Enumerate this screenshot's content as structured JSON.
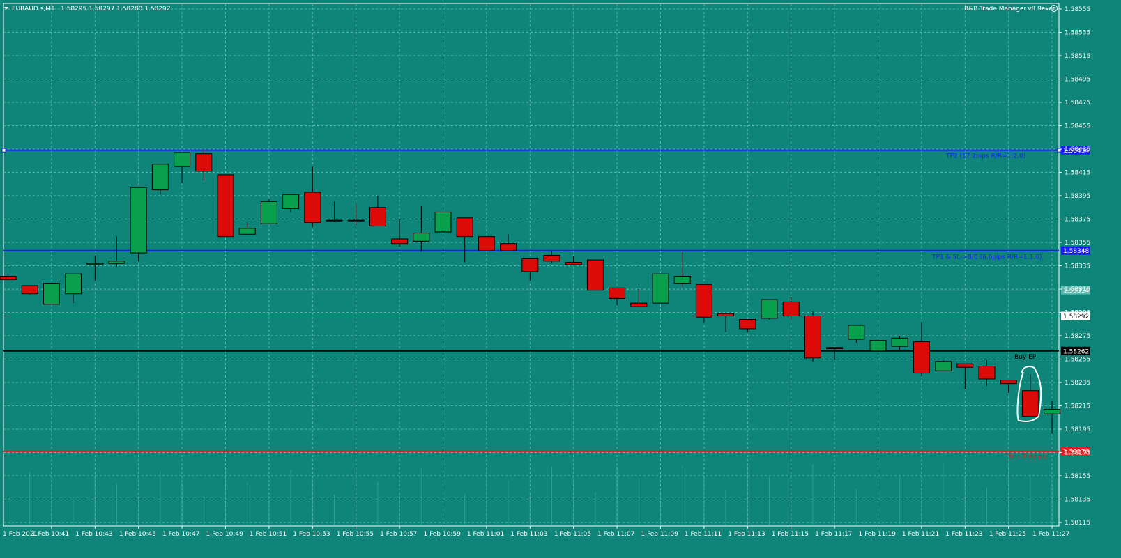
{
  "header": {
    "symbol_label": "EURAUD.s,M1",
    "ohlc_text": "1.58295 1.58297 1.58280 1.58292",
    "ea_label": "B&B Trade Manager.v8.9exec"
  },
  "colors": {
    "background": "#0f8478",
    "bull": "#08a04c",
    "bear": "#dd0a0a",
    "grid": "#5cb8ad",
    "tp_line": "#1a1aff",
    "entry_line": "#000000",
    "sl_line": "#e02020",
    "current_price": "#ffffff"
  },
  "chart_data": {
    "type": "candlestick",
    "symbol": "EURAUD.s",
    "timeframe": "M1",
    "y_range": [
      1.58115,
      1.58565
    ],
    "y_ticks": [
      "1.58555",
      "1.58535",
      "1.58515",
      "1.58495",
      "1.58475",
      "1.58455",
      "1.58435",
      "1.58415",
      "1.58395",
      "1.58375",
      "1.58355",
      "1.58335",
      "1.58315",
      "1.58295",
      "1.58275",
      "1.58255",
      "1.58235",
      "1.58215",
      "1.58195",
      "1.58175",
      "1.58155",
      "1.58135",
      "1.58115"
    ],
    "x_labels": [
      "1 Feb 2021",
      "1 Feb 10:41",
      "1 Feb 10:43",
      "1 Feb 10:45",
      "1 Feb 10:47",
      "1 Feb 10:49",
      "1 Feb 10:51",
      "1 Feb 10:53",
      "1 Feb 10:55",
      "1 Feb 10:57",
      "1 Feb 10:59",
      "1 Feb 11:01",
      "1 Feb 11:03",
      "1 Feb 11:05",
      "1 Feb 11:07",
      "1 Feb 11:09",
      "1 Feb 11:11",
      "1 Feb 11:13",
      "1 Feb 11:15",
      "1 Feb 11:17",
      "1 Feb 11:19",
      "1 Feb 11:21",
      "1 Feb 11:23",
      "1 Feb 11:25",
      "1 Feb 11:27"
    ],
    "candles": [
      {
        "o": 1.58326,
        "h": 1.58334,
        "l": 1.58324,
        "c": 1.58323
      },
      {
        "o": 1.58318,
        "h": 1.58318,
        "l": 1.5831,
        "c": 1.58311
      },
      {
        "o": 1.58302,
        "h": 1.5832,
        "l": 1.58302,
        "c": 1.5832
      },
      {
        "o": 1.58311,
        "h": 1.58328,
        "l": 1.58303,
        "c": 1.58328
      },
      {
        "o": 1.58336,
        "h": 1.58344,
        "l": 1.58322,
        "c": 1.58337
      },
      {
        "o": 1.58337,
        "h": 1.5836,
        "l": 1.58334,
        "c": 1.58339
      },
      {
        "o": 1.58346,
        "h": 1.58402,
        "l": 1.58339,
        "c": 1.58402
      },
      {
        "o": 1.584,
        "h": 1.58422,
        "l": 1.58396,
        "c": 1.58422
      },
      {
        "o": 1.5842,
        "h": 1.5843,
        "l": 1.58406,
        "c": 1.58432
      },
      {
        "o": 1.58431,
        "h": 1.58434,
        "l": 1.58408,
        "c": 1.58416
      },
      {
        "o": 1.58413,
        "h": 1.58413,
        "l": 1.5836,
        "c": 1.5836
      },
      {
        "o": 1.58362,
        "h": 1.58372,
        "l": 1.58362,
        "c": 1.58367
      },
      {
        "o": 1.58371,
        "h": 1.58392,
        "l": 1.58371,
        "c": 1.5839
      },
      {
        "o": 1.58384,
        "h": 1.58396,
        "l": 1.58381,
        "c": 1.58396
      },
      {
        "o": 1.58398,
        "h": 1.5842,
        "l": 1.58368,
        "c": 1.58372
      },
      {
        "o": 1.58374,
        "h": 1.5839,
        "l": 1.58373,
        "c": 1.58374
      },
      {
        "o": 1.58374,
        "h": 1.58388,
        "l": 1.5837,
        "c": 1.58374
      },
      {
        "o": 1.58385,
        "h": 1.58395,
        "l": 1.58369,
        "c": 1.58369
      },
      {
        "o": 1.58358,
        "h": 1.58375,
        "l": 1.58351,
        "c": 1.58354
      },
      {
        "o": 1.58356,
        "h": 1.58386,
        "l": 1.58347,
        "c": 1.58363
      },
      {
        "o": 1.58364,
        "h": 1.58381,
        "l": 1.58364,
        "c": 1.58381
      },
      {
        "o": 1.58376,
        "h": 1.58376,
        "l": 1.58338,
        "c": 1.5836
      },
      {
        "o": 1.5836,
        "h": 1.5836,
        "l": 1.58348,
        "c": 1.58348
      },
      {
        "o": 1.58354,
        "h": 1.58362,
        "l": 1.58348,
        "c": 1.58348
      },
      {
        "o": 1.58341,
        "h": 1.58341,
        "l": 1.58322,
        "c": 1.5833
      },
      {
        "o": 1.58344,
        "h": 1.58348,
        "l": 1.58337,
        "c": 1.58339
      },
      {
        "o": 1.58338,
        "h": 1.58343,
        "l": 1.58335,
        "c": 1.58336
      },
      {
        "o": 1.5834,
        "h": 1.5834,
        "l": 1.58314,
        "c": 1.58314
      },
      {
        "o": 1.58316,
        "h": 1.58316,
        "l": 1.58301,
        "c": 1.58307
      },
      {
        "o": 1.58303,
        "h": 1.58315,
        "l": 1.583,
        "c": 1.583
      },
      {
        "o": 1.58303,
        "h": 1.58328,
        "l": 1.58303,
        "c": 1.58328
      },
      {
        "o": 1.5832,
        "h": 1.58347,
        "l": 1.58317,
        "c": 1.58326
      },
      {
        "o": 1.58319,
        "h": 1.58319,
        "l": 1.58286,
        "c": 1.58291
      },
      {
        "o": 1.58294,
        "h": 1.58294,
        "l": 1.58278,
        "c": 1.58292
      },
      {
        "o": 1.58289,
        "h": 1.58289,
        "l": 1.58278,
        "c": 1.58281
      },
      {
        "o": 1.5829,
        "h": 1.58306,
        "l": 1.58289,
        "c": 1.58306
      },
      {
        "o": 1.58304,
        "h": 1.58308,
        "l": 1.58289,
        "c": 1.58292
      },
      {
        "o": 1.58292,
        "h": 1.58296,
        "l": 1.58253,
        "c": 1.58256
      },
      {
        "o": 1.58264,
        "h": 1.58265,
        "l": 1.58254,
        "c": 1.58265
      },
      {
        "o": 1.58272,
        "h": 1.58282,
        "l": 1.58269,
        "c": 1.58284
      },
      {
        "o": 1.58262,
        "h": 1.58271,
        "l": 1.58262,
        "c": 1.58271
      },
      {
        "o": 1.58266,
        "h": 1.58275,
        "l": 1.58263,
        "c": 1.58273
      },
      {
        "o": 1.5827,
        "h": 1.58287,
        "l": 1.5824,
        "c": 1.58243
      },
      {
        "o": 1.58245,
        "h": 1.58254,
        "l": 1.58245,
        "c": 1.58253
      },
      {
        "o": 1.58251,
        "h": 1.58251,
        "l": 1.58229,
        "c": 1.58248
      },
      {
        "o": 1.58249,
        "h": 1.58254,
        "l": 1.58232,
        "c": 1.58238
      },
      {
        "o": 1.58237,
        "h": 1.58237,
        "l": 1.58226,
        "c": 1.58234
      },
      {
        "o": 1.58228,
        "h": 1.58242,
        "l": 1.58206,
        "c": 1.58206
      },
      {
        "o": 1.58208,
        "h": 1.58219,
        "l": 1.58191,
        "c": 1.58212
      }
    ],
    "levels": [
      {
        "name": "TP2",
        "price": 1.58434,
        "box_text": "1.58434",
        "label": "TP2 (17.2pips R/R=1:2.0)",
        "color": "#1a1aff",
        "box_bg": "#1a1aff",
        "box_fg": "#ffffff"
      },
      {
        "name": "TP1",
        "price": 1.58348,
        "box_text": "1.58348",
        "label": "TP1 & SL->B/E (8.6pips R/R=1:1.0)",
        "color": "#1a1aff",
        "box_bg": "#1a1aff",
        "box_fg": "#ffffff"
      },
      {
        "name": "Buy EP",
        "price": 1.58262,
        "box_text": "1.58262",
        "label": "Buy EP",
        "color": "#000000",
        "box_bg": "#000000",
        "box_fg": "#ffffff"
      },
      {
        "name": "SL",
        "price": 1.58176,
        "box_text": "1.58176",
        "label": "SL (-8.6pips)",
        "color": "#e02020",
        "box_bg": "#e02020",
        "box_fg": "#ffffff"
      }
    ],
    "extra_price_boxes": [
      {
        "price": 1.58314,
        "text": "1.58314",
        "bg": "#5cb8ad",
        "fg": "#ffffff"
      },
      {
        "price": 1.58292,
        "text": "1.58292",
        "bg": "#ffffff",
        "fg": "#000000"
      }
    ],
    "highlight_candle_index": 47
  }
}
